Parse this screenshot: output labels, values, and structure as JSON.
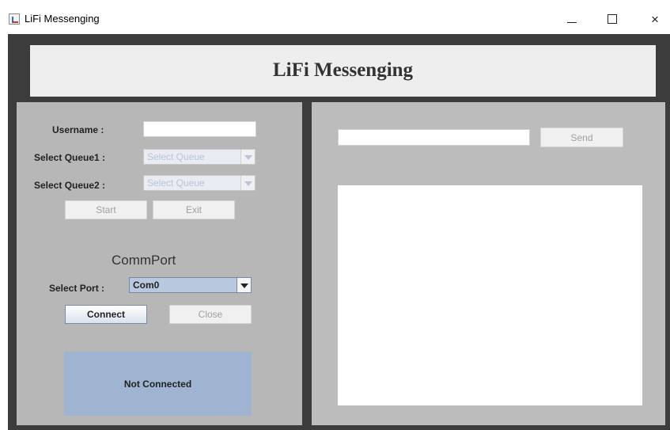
{
  "window": {
    "title": "LiFi Messenging",
    "controls": {
      "minimize": "minimize",
      "maximize": "maximize",
      "close": "×"
    }
  },
  "header": {
    "title": "LiFi Messenging"
  },
  "left": {
    "username_label": "Username :",
    "username_value": "",
    "queue1_label": "Select Queue1 :",
    "queue1_value": "Select Queue",
    "queue2_label": "Select Queue2 :",
    "queue2_value": "Select Queue",
    "start_label": "Start",
    "exit_label": "Exit",
    "commport_title": "CommPort",
    "port_label": "Select Port :",
    "port_value": "Com0",
    "connect_label": "Connect",
    "close_label": "Close",
    "status_text": "Not Connected"
  },
  "right": {
    "message_value": "",
    "send_label": "Send",
    "messages_content": ""
  },
  "icons": {
    "app": "java-cup-icon",
    "minimize": "minimize-icon",
    "maximize": "maximize-icon",
    "close": "close-icon",
    "combo_arrow": "chevron-down-icon"
  },
  "colors": {
    "frame": "#3c3c3c",
    "left_panel": "#b7b7b7",
    "right_panel": "#bcbcbc",
    "status_box": "#9eb4d0",
    "header_panel": "#eeeeee"
  }
}
